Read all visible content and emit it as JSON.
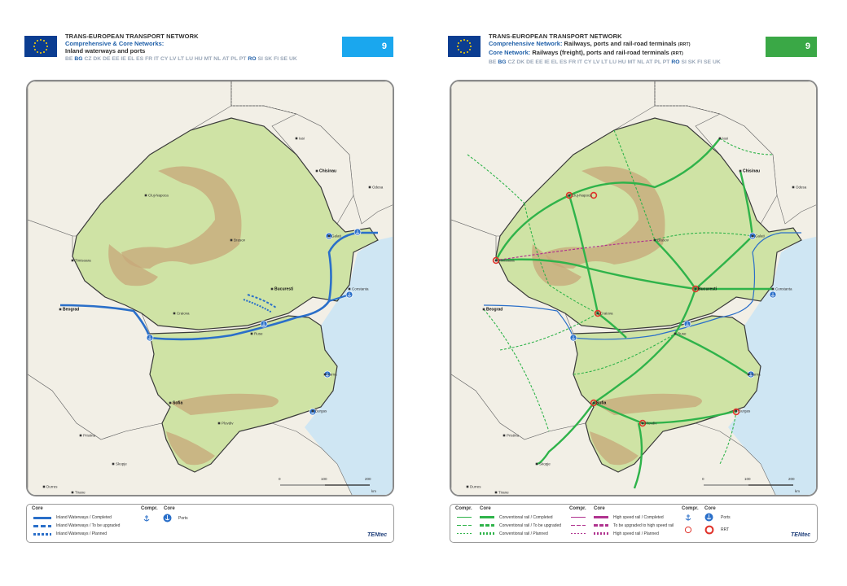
{
  "left": {
    "header": {
      "title": "TRANS-EUROPEAN TRANSPORT NETWORK",
      "subtitle": "Comprehensive & Core Networks:",
      "subtitle2": "Inland waterways and ports",
      "countries_pre": "BE",
      "countries_hl1": "BG",
      "countries_mid": "CZ DK DE EE IE EL ES FR IT CY LV LT LU HU MT NL AT PL PT",
      "countries_hl2": "RO",
      "countries_post": "SI SK FI SE UK",
      "badge": "9",
      "badge_color": "#1aa7ee"
    },
    "legend": {
      "core_label": "Core",
      "compr_label": "Compr.",
      "core_label2": "Core",
      "items": [
        "Inland Waterways / Completed",
        "Inland Waterways / To be upgraded",
        "Inland Waterways / Planned"
      ],
      "ports": "Ports",
      "brand": "TENtec"
    }
  },
  "right": {
    "header": {
      "title": "TRANS-EUROPEAN TRANSPORT NETWORK",
      "subtitle_a": "Comprehensive Network:",
      "subtitle_b": "Railways, ports and rail-road terminals",
      "subtitle_c": "(RRT)",
      "subtitle2_a": "Core Network:",
      "subtitle2_b": "Railways (freight), ports and rail-road terminals",
      "subtitle2_c": "(RRT)",
      "countries_pre": "BE",
      "countries_hl1": "BG",
      "countries_mid": "CZ DK DE EE IE EL ES FR IT CY LV LT LU HU MT NL AT PL PT",
      "countries_hl2": "RO",
      "countries_post": "SI SK FI SE UK",
      "badge": "9",
      "badge_color": "#3aa846"
    },
    "legend": {
      "compr_label": "Compr.",
      "core_label": "Core",
      "compr_label2": "Compr.",
      "core_label2": "Core",
      "rail_items": [
        "Conventional rail / Completed",
        "Conventional rail / To be upgraded",
        "Conventional rail / Planned"
      ],
      "hs_items": [
        "High speed rail / Completed",
        "To be upgraded to high speed rail",
        "High speed rail / Planned"
      ],
      "ports": "Ports",
      "rrt": "RRT",
      "brand": "TENtec"
    }
  },
  "map": {
    "cities": [
      "Chisinau",
      "Odesa",
      "Bucuresti",
      "Beograd",
      "Sofia",
      "Skopje",
      "Pristina",
      "Tirane",
      "Durres",
      "Craiova",
      "Constanta",
      "Varna",
      "Burgas",
      "Plovdiv",
      "Cluj-Napoca",
      "Timisoara",
      "Brasov",
      "Galati",
      "Ruse",
      "Iasi"
    ],
    "scale": {
      "zero": "0",
      "mid": "100",
      "max": "200",
      "unit": "km"
    }
  },
  "colors": {
    "waterway": "#2a6fc9",
    "rail": "#2fb34a",
    "highspeed": "#b0338f",
    "rrt": "#e0332b",
    "land_ro_bg": "#cfe3a5",
    "land_other": "#f2efe6",
    "sea": "#cfe6f3"
  }
}
